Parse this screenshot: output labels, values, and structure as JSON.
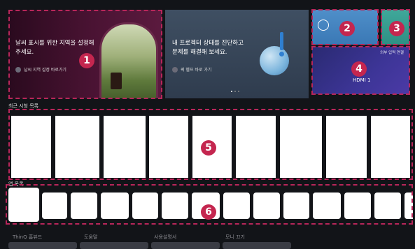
{
  "banner1": {
    "text_line1": "날씨 표시를 위한 지역을 설정해",
    "text_line2": "주세요.",
    "link": "날씨 지역 설정 바로가기"
  },
  "banner2": {
    "text_line1": "내 프로젝터 상태를 진단하고",
    "text_line2": "문제를 해결해 보세요.",
    "link": "퀵 헬프 바로 가기"
  },
  "input_card": {
    "top_label": "외부 입력 연결",
    "label": "HDMI 1"
  },
  "sections": {
    "recent_label": "최근 시청 목록",
    "apps_label": "앱 목록"
  },
  "bottom_labels": [
    "ThinQ 홈뷰드",
    "도움말",
    "사용설명서",
    "모니 끄기"
  ],
  "badges": [
    "1",
    "2",
    "3",
    "4",
    "5",
    "6"
  ],
  "colors": {
    "accent": "#c4264f",
    "background": "#121418"
  }
}
